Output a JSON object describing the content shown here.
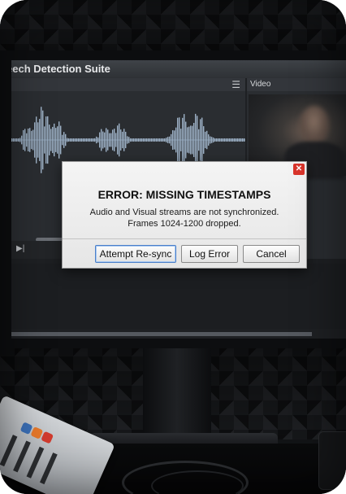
{
  "app": {
    "window_title": "eech Detection Suite",
    "menu_icon": "menu-icon",
    "video_panel_label": "Video",
    "transport_icon": "skip-forward-icon"
  },
  "dialog": {
    "title": "ERROR: MISSING TIMESTAMPS",
    "message_line1": "Audio and Visual streams are not synchronized.",
    "message_line2": "Frames 1024-1200 dropped.",
    "close_icon": "close-icon",
    "buttons": {
      "resync": "Attempt Re-sync",
      "log": "Log Error",
      "cancel": "Cancel"
    }
  },
  "colors": {
    "close_button": "#d9342b",
    "waveform": "#9fb3c8",
    "focus_outline": "#4a7fc9",
    "video_scrub": "#8fb7e8"
  }
}
